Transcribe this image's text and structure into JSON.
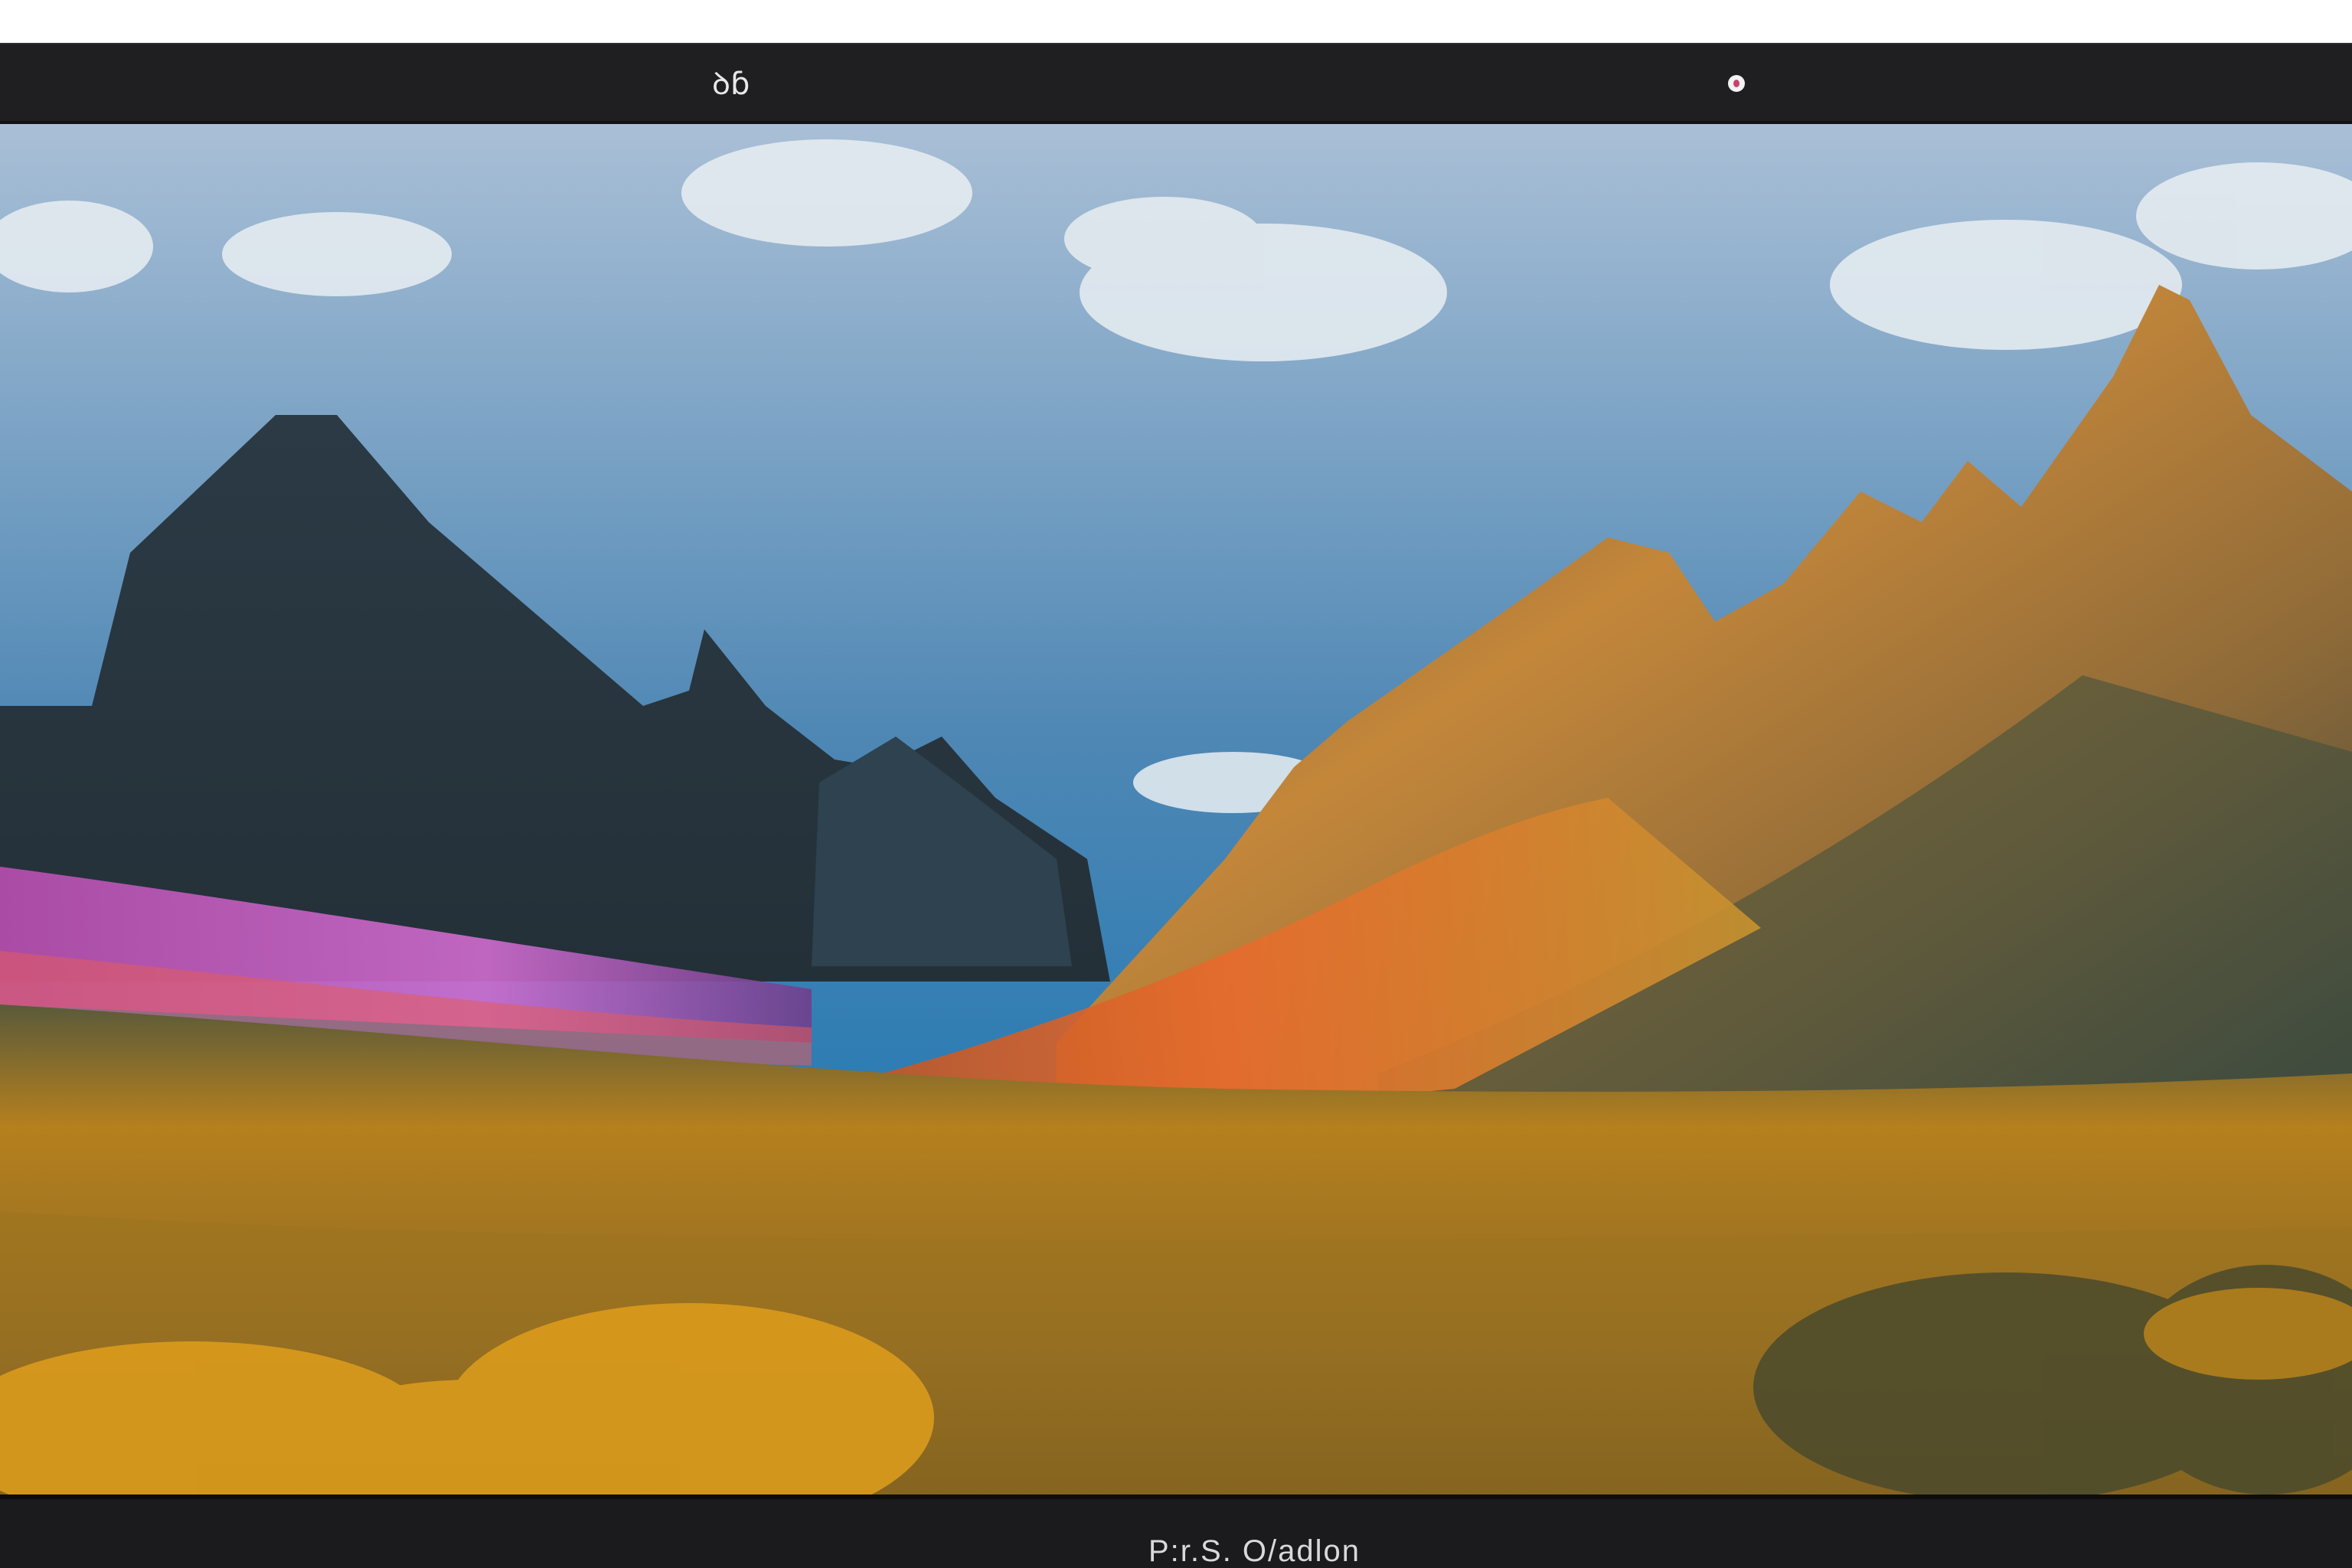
{
  "top_bar": {
    "left_glyph": "ꝺɓ",
    "right_icon": "record-dot-icon"
  },
  "bottom_bar": {
    "caption": "P:r.S. O/adlon"
  },
  "colors": {
    "bar_background": "#1f1f21",
    "accent_dot": "#c7426f"
  }
}
